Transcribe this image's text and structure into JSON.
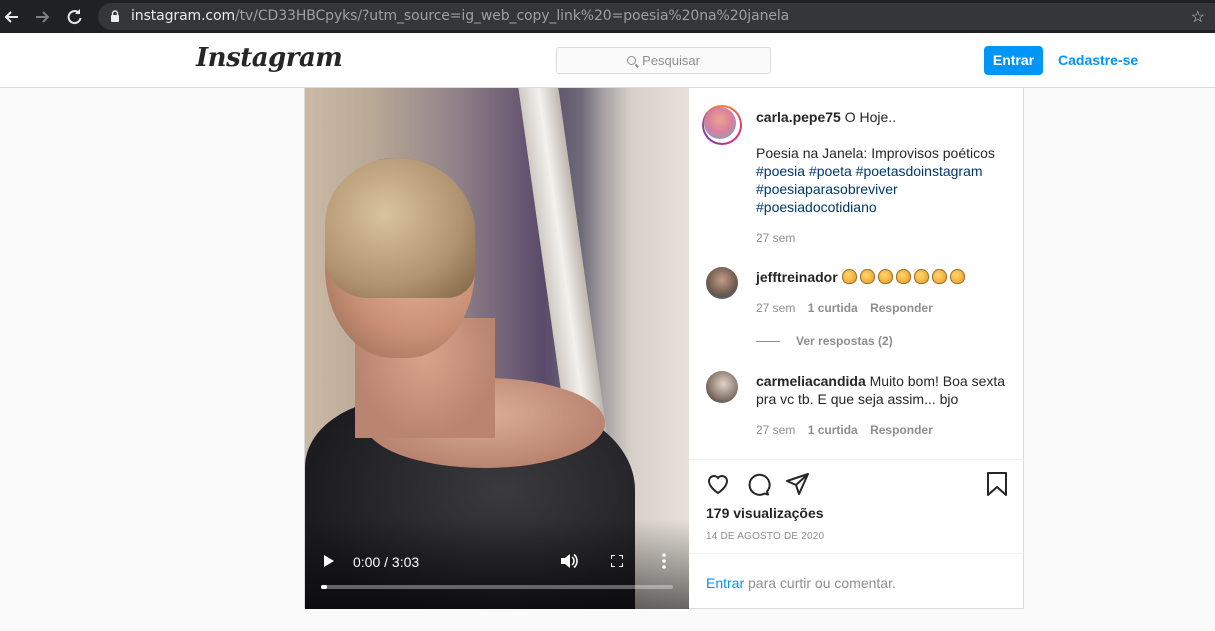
{
  "browser": {
    "url_host": "instagram.com",
    "url_path": "/tv/CD33HBCpyks/?utm_source=ig_web_copy_link%20=poesia%20na%20janela"
  },
  "header": {
    "logo": "Instagram",
    "search_placeholder": "Pesquisar",
    "login_label": "Entrar",
    "signup_label": "Cadastre-se",
    "accent_color": "#0095f6"
  },
  "video": {
    "time": "0:00 / 3:03",
    "progress_fraction": 0.0
  },
  "post": {
    "author": "carla.pepe75",
    "caption_first": "O Hoje..",
    "caption_line2": "Poesia na Janela: Improvisos poéticos",
    "hashtags": [
      "#poesia",
      "#poeta",
      "#poetasdoinstagram",
      "#poesiaparasobreviver",
      "#poesiadocotidiano"
    ],
    "time": "27 sem",
    "views": "179 visualizações",
    "date": "14 DE AGOSTO DE 2020"
  },
  "comments": [
    {
      "user": "jefftreinador",
      "text": "👏👏👏👏👏👏👏",
      "time": "27 sem",
      "likes": "1 curtida",
      "reply": "Responder",
      "view_replies": "Ver respostas (2)"
    },
    {
      "user": "carmeliacandida",
      "text": "Muito bom! Boa sexta pra vc tb. E que seja assim... bjo",
      "time": "27 sem",
      "likes": "1 curtida",
      "reply": "Responder"
    }
  ],
  "footer": {
    "login_link": "Entrar",
    "prompt": " para curtir ou comentar."
  }
}
